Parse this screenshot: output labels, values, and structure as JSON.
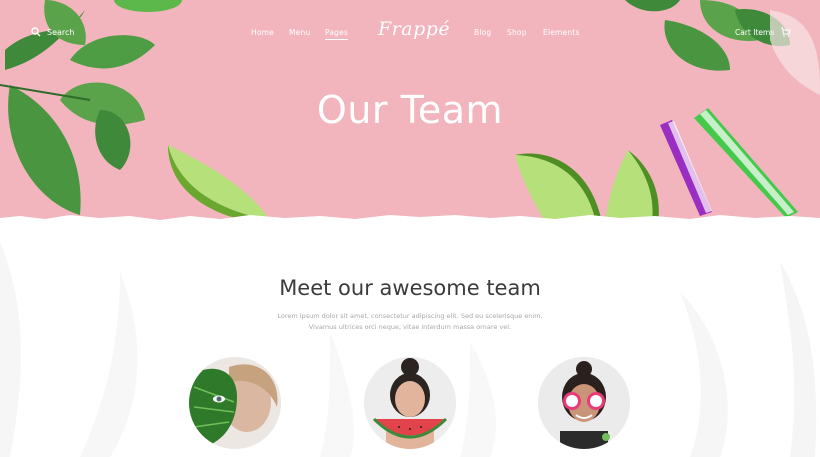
{
  "nav": {
    "search_label": "Search",
    "items": [
      {
        "label": "Home"
      },
      {
        "label": "Menu"
      },
      {
        "label": "Pages"
      },
      {
        "label": "Blog"
      },
      {
        "label": "Shop"
      },
      {
        "label": "Elements"
      }
    ],
    "logo": "Frappé",
    "cart_label": "Cart Items"
  },
  "hero": {
    "title": "Our Team"
  },
  "team_section": {
    "title": "Meet our awesome team",
    "description_line1": "Lorem ipsum dolor sit amet, consectetur adipiscing elit. Sed eu scelerisque enim.",
    "description_line2": "Vivamus ultrices orci neque, vitae interdum massa ornare vel."
  },
  "colors": {
    "hero_bg": "#f2b5bd",
    "leaf_green": "#3f8a3a",
    "lime": "#8cc63f",
    "straw_green": "#44c94a",
    "straw_purple": "#9b2ec2"
  }
}
